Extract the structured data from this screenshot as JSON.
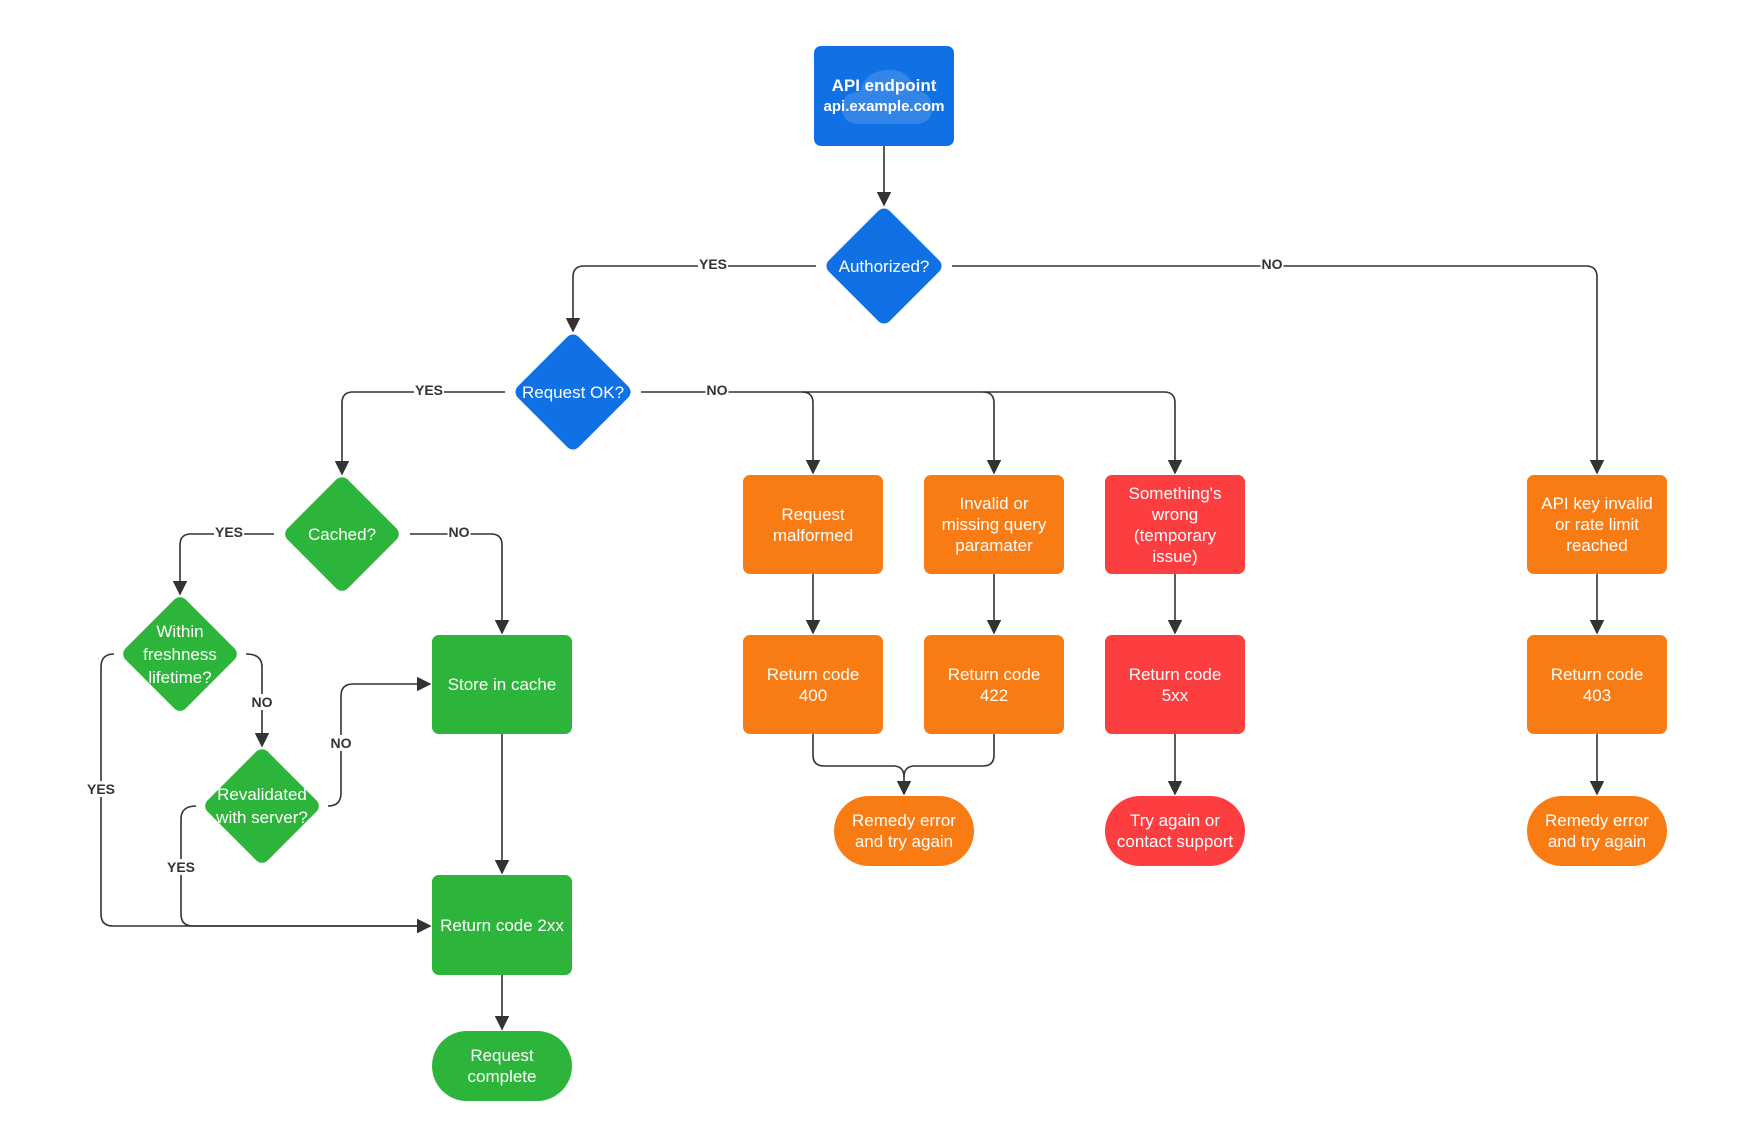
{
  "diagram": {
    "type": "flowchart",
    "colors": {
      "start": "#1071e5",
      "decision_primary": "#1071e5",
      "success": "#2db53b",
      "client_error": "#f87b14",
      "server_error": "#fd3e40",
      "connector": "#333333"
    },
    "nodes": {
      "api_endpoint": {
        "title": "API endpoint",
        "subtitle": "api.example.com",
        "icon": "cloud-icon"
      },
      "authorized": {
        "label": "Authorized?"
      },
      "request_ok": {
        "label": "Request OK?"
      },
      "cached": {
        "label": "Cached?"
      },
      "within_freshness": {
        "label": "Within freshness lifetime?"
      },
      "revalidated": {
        "label": "Revalidated with server?"
      },
      "store_in_cache": {
        "label": "Store in cache"
      },
      "return_2xx": {
        "label": "Return code 2xx"
      },
      "request_complete": {
        "label": "Request complete"
      },
      "request_malformed": {
        "label": "Request malformed"
      },
      "invalid_query": {
        "label": "Invalid or missing query paramater"
      },
      "something_wrong": {
        "label": "Something's wrong (temporary issue)"
      },
      "api_key_invalid": {
        "label": "API key invalid or rate limit reached"
      },
      "return_400": {
        "label": "Return code 400"
      },
      "return_422": {
        "label": "Return code 422"
      },
      "return_5xx": {
        "label": "Return code 5xx"
      },
      "return_403": {
        "label": "Return code 403"
      },
      "remedy_1": {
        "label": "Remedy error and try again"
      },
      "try_again_support": {
        "label": "Try again or contact support"
      },
      "remedy_2": {
        "label": "Remedy error and try again"
      }
    },
    "edge_labels": {
      "auth_yes": "YES",
      "auth_no": "NO",
      "reqok_yes": "YES",
      "reqok_no": "NO",
      "cached_yes": "YES",
      "cached_no": "NO",
      "fresh_yes": "YES",
      "fresh_no": "NO",
      "reval_yes": "YES",
      "reval_no": "NO"
    },
    "edges": [
      {
        "from": "api_endpoint",
        "to": "authorized"
      },
      {
        "from": "authorized",
        "to": "request_ok",
        "label": "YES"
      },
      {
        "from": "authorized",
        "to": "api_key_invalid",
        "label": "NO"
      },
      {
        "from": "request_ok",
        "to": "cached",
        "label": "YES"
      },
      {
        "from": "request_ok",
        "to": "request_malformed",
        "label": "NO"
      },
      {
        "from": "request_ok",
        "to": "invalid_query",
        "label": "NO"
      },
      {
        "from": "request_ok",
        "to": "something_wrong",
        "label": "NO"
      },
      {
        "from": "cached",
        "to": "within_freshness",
        "label": "YES"
      },
      {
        "from": "cached",
        "to": "store_in_cache",
        "label": "NO"
      },
      {
        "from": "within_freshness",
        "to": "return_2xx",
        "label": "YES"
      },
      {
        "from": "within_freshness",
        "to": "revalidated",
        "label": "NO"
      },
      {
        "from": "revalidated",
        "to": "return_2xx",
        "label": "YES"
      },
      {
        "from": "revalidated",
        "to": "store_in_cache",
        "label": "NO"
      },
      {
        "from": "store_in_cache",
        "to": "return_2xx"
      },
      {
        "from": "return_2xx",
        "to": "request_complete"
      },
      {
        "from": "request_malformed",
        "to": "return_400"
      },
      {
        "from": "invalid_query",
        "to": "return_422"
      },
      {
        "from": "return_400",
        "to": "remedy_1"
      },
      {
        "from": "return_422",
        "to": "remedy_1"
      },
      {
        "from": "something_wrong",
        "to": "return_5xx"
      },
      {
        "from": "return_5xx",
        "to": "try_again_support"
      },
      {
        "from": "api_key_invalid",
        "to": "return_403"
      },
      {
        "from": "return_403",
        "to": "remedy_2"
      }
    ]
  }
}
